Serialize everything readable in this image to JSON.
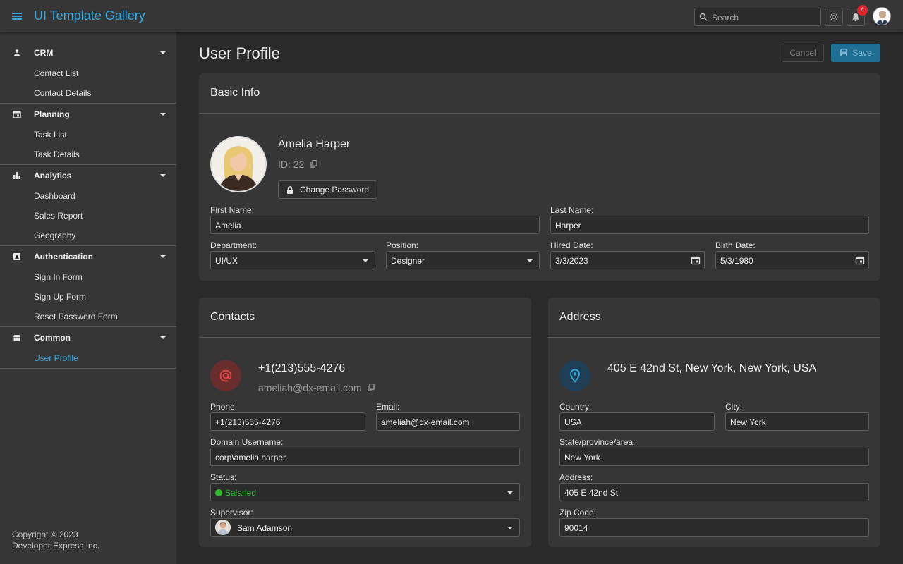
{
  "app": {
    "title": "UI Template Gallery"
  },
  "search": {
    "placeholder": "Search"
  },
  "notifications": {
    "count": "4"
  },
  "sidebar": {
    "groups": [
      {
        "label": "CRM",
        "icon": "person-icon",
        "items": [
          {
            "label": "Contact List"
          },
          {
            "label": "Contact Details"
          }
        ]
      },
      {
        "label": "Planning",
        "icon": "calendar-icon",
        "items": [
          {
            "label": "Task List"
          },
          {
            "label": "Task Details"
          }
        ]
      },
      {
        "label": "Analytics",
        "icon": "bar-chart-icon",
        "items": [
          {
            "label": "Dashboard"
          },
          {
            "label": "Sales Report"
          },
          {
            "label": "Geography"
          }
        ]
      },
      {
        "label": "Authentication",
        "icon": "id-badge-icon",
        "items": [
          {
            "label": "Sign In Form"
          },
          {
            "label": "Sign Up Form"
          },
          {
            "label": "Reset Password Form"
          }
        ]
      },
      {
        "label": "Common",
        "icon": "box-icon",
        "items": [
          {
            "label": "User Profile",
            "active": true
          }
        ]
      }
    ],
    "copyright_line1": "Copyright © 2023",
    "copyright_line2": "Developer Express Inc."
  },
  "page": {
    "title": "User Profile",
    "cancel_label": "Cancel",
    "save_label": "Save"
  },
  "basic_info": {
    "title": "Basic Info",
    "name": "Amelia Harper",
    "id_text": "ID: 22",
    "change_password_label": "Change Password",
    "first_name": {
      "label": "First Name:",
      "value": "Amelia"
    },
    "last_name": {
      "label": "Last Name:",
      "value": "Harper"
    },
    "department": {
      "label": "Department:",
      "value": "UI/UX"
    },
    "position": {
      "label": "Position:",
      "value": "Designer"
    },
    "hired_date": {
      "label": "Hired Date:",
      "value": "3/3/2023"
    },
    "birth_date": {
      "label": "Birth Date:",
      "value": "5/3/1980"
    }
  },
  "contacts": {
    "title": "Contacts",
    "phone_display": "+1(213)555-4276",
    "email_display": "ameliah@dx-email.com",
    "phone": {
      "label": "Phone:",
      "value": "+1(213)555-4276"
    },
    "email": {
      "label": "Email:",
      "value": "ameliah@dx-email.com"
    },
    "domain_username": {
      "label": "Domain Username:",
      "value": "corp\\amelia.harper"
    },
    "status": {
      "label": "Status:",
      "value": "Salaried",
      "color": "#2eb82e"
    },
    "supervisor": {
      "label": "Supervisor:",
      "value": "Sam Adamson"
    }
  },
  "address": {
    "title": "Address",
    "full_address": "405 E 42nd St, New York, New York, USA",
    "country": {
      "label": "Country:",
      "value": "USA"
    },
    "city": {
      "label": "City:",
      "value": "New York"
    },
    "state": {
      "label": "State/province/area:",
      "value": "New York"
    },
    "street": {
      "label": "Address:",
      "value": "405 E 42nd St"
    },
    "zip": {
      "label": "Zip Code:",
      "value": "90014"
    }
  },
  "colors": {
    "accent": "#35a9e0",
    "badge": "#e0242a",
    "status_green": "#2eb82e",
    "email_icon": "#e84545",
    "location_icon": "#35a9e0"
  }
}
